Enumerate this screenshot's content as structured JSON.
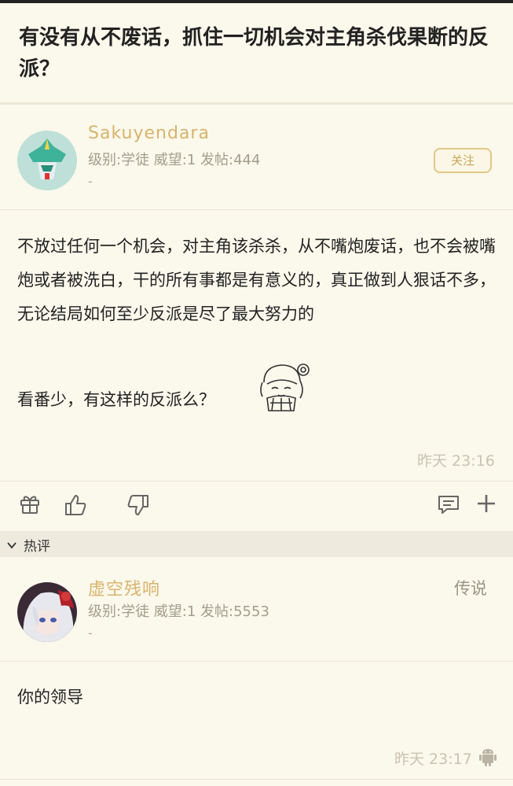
{
  "post": {
    "title": "有没有从不废话，抓住一切机会对主角杀伐果断的反派？",
    "author": {
      "name": "Sakuyendara",
      "meta": "级别:学徒 威望:1 发帖:444",
      "sub": "-"
    },
    "follow_label": "关注",
    "paragraphs": [
      "不放过任何一个机会，对主角该杀杀，从不嘴炮废话，也不会被嘴炮或者被洗白，干的所有事都是有意义的，真正做到人狠话不多，无论结局如何至少反派是尽了最大努力的",
      "看番少，有这样的反派么？"
    ],
    "time": "昨天 23:16"
  },
  "hot_comments_label": "热评",
  "comment": {
    "author": {
      "name": "虚空残响",
      "meta": "级别:学徒 威望:1 发帖:5553",
      "sub": "-"
    },
    "rank": "传说",
    "text": "你的领导",
    "time": "昨天 23:17"
  },
  "icons": [
    "gift-icon",
    "thumbs-up-icon",
    "thumbs-down-icon",
    "comment-icon",
    "plus-icon",
    "chevron-down-icon",
    "android-icon"
  ],
  "colors": {
    "background": "#fbf8ec",
    "username": "#d8b46c",
    "follow_border": "#e2c886",
    "section_bar": "#efeade"
  }
}
